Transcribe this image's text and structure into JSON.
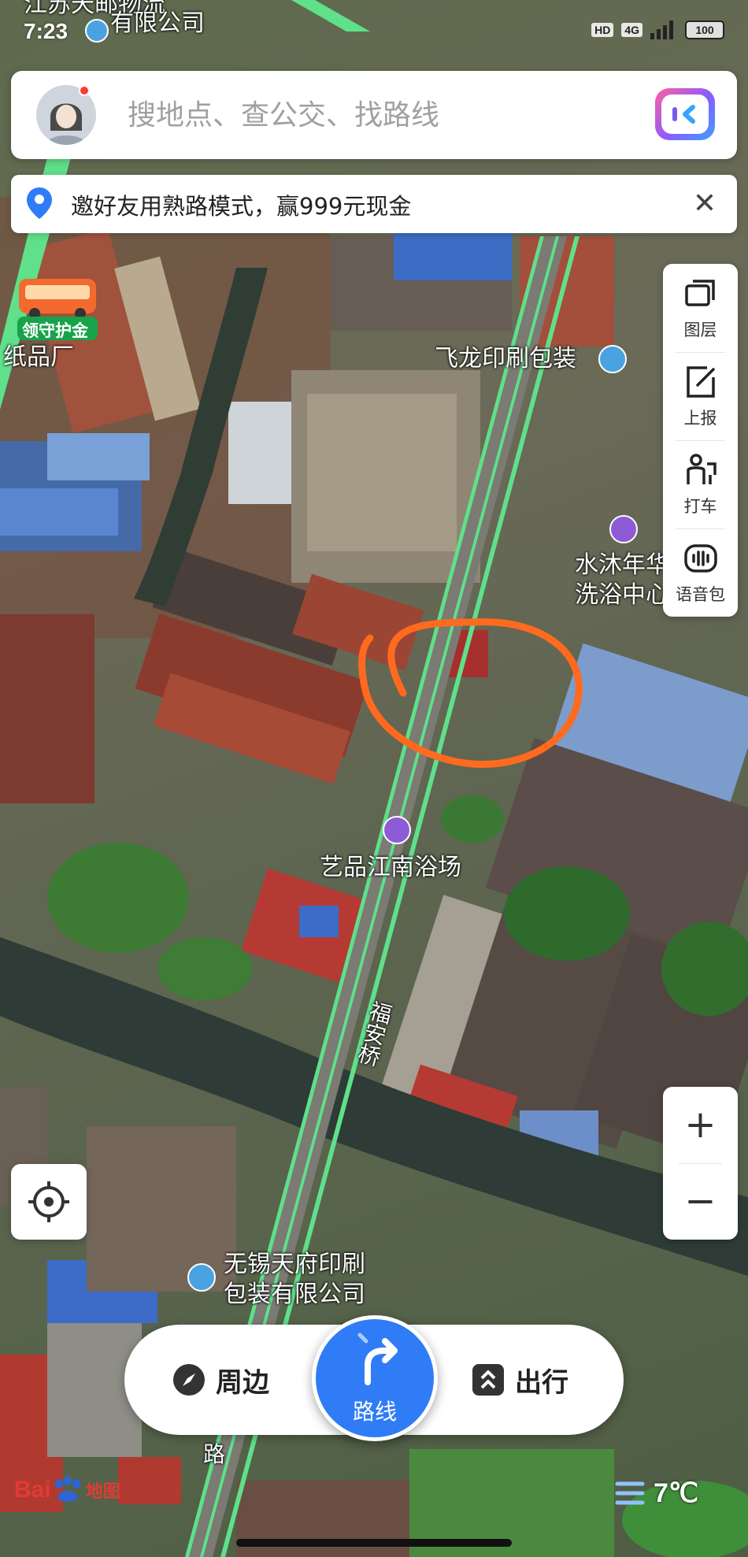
{
  "status_bar": {
    "time": "7:23",
    "hd_badge": "HD",
    "network": "4G",
    "battery": "100"
  },
  "search": {
    "placeholder": "搜地点、查公交、找路线"
  },
  "promo_banner": {
    "text": "邀好友用熟路模式，赢999元现金"
  },
  "promo_badge": {
    "label": "领守护金"
  },
  "tools": [
    {
      "label": "图层",
      "icon": "layers-icon"
    },
    {
      "label": "上报",
      "icon": "report-edit-icon"
    },
    {
      "label": "打车",
      "icon": "taxi-person-icon"
    },
    {
      "label": "语音包",
      "icon": "voice-pack-icon"
    }
  ],
  "zoom": {
    "in": "+",
    "out": "−"
  },
  "map_labels": {
    "top_company": "有限公司",
    "top_company_partial": "江苏天邮物流",
    "paper_factory": "纸品厂",
    "feilong": "飞龙印刷包装",
    "bath_1_line1": "水沐年华",
    "bath_1_line2": "洗浴中心",
    "yipin": "艺品江南浴场",
    "road": "福安桥",
    "road_bottom": "路",
    "tianfu_line1": "无锡天府印刷",
    "tianfu_line2": "包装有限公司"
  },
  "bottom_nav": {
    "nearby": "周边",
    "route": "路线",
    "travel": "出行"
  },
  "brand": {
    "text_en": "Bai",
    "text_cn": "地图"
  },
  "weather": {
    "temperature": "7℃"
  },
  "colors": {
    "accent_blue": "#2f7cf6",
    "annotation_orange": "#ff6a1f",
    "road_green": "#5fe08a",
    "poi_purple": "#8e5bd6",
    "poi_blue": "#4aa3e0"
  }
}
